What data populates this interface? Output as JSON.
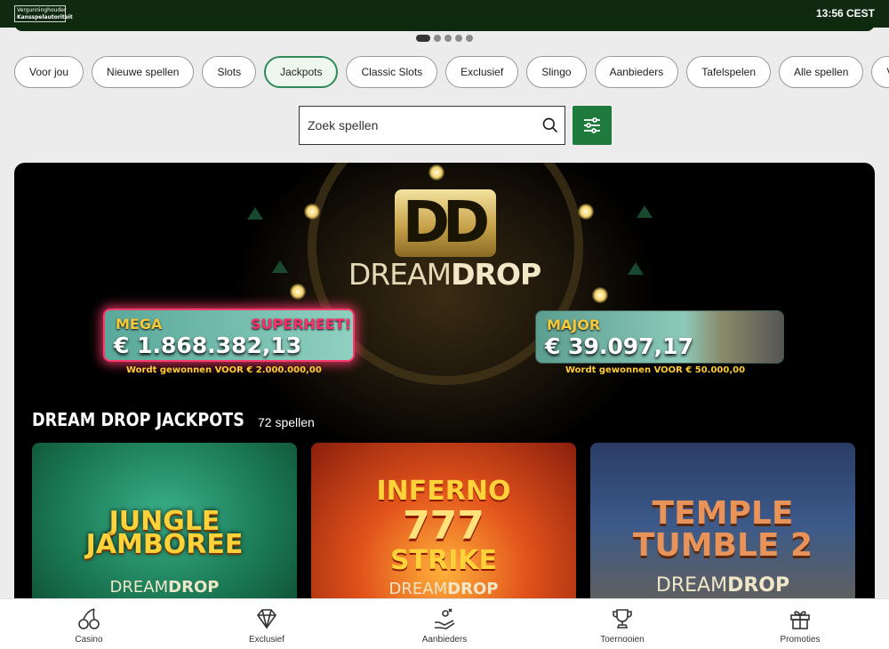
{
  "header": {
    "license_line1": "Vergunninghouder",
    "license_line2": "Kansspelautoriteit",
    "clock": "13:56 CEST"
  },
  "carousel": {
    "dot_count": 5,
    "active_index": 0
  },
  "filters": {
    "chips": [
      {
        "label": "Voor jou"
      },
      {
        "label": "Nieuwe spellen"
      },
      {
        "label": "Slots"
      },
      {
        "label": "Jackpots",
        "active": true
      },
      {
        "label": "Classic Slots"
      },
      {
        "label": "Exclusief"
      },
      {
        "label": "Slingo"
      },
      {
        "label": "Aanbieders"
      },
      {
        "label": "Tafelspelen"
      },
      {
        "label": "Alle spellen"
      },
      {
        "label": "V"
      }
    ]
  },
  "search": {
    "placeholder": "Zoek spellen",
    "icon": "search-icon",
    "filter_icon": "sliders-icon"
  },
  "banner": {
    "logo_letters": "DD",
    "brand_light": "DREAM",
    "brand_bold": "DROP",
    "jackpots": [
      {
        "label": "MEGA",
        "status": "SUPERHEET!",
        "amount": "€ 1.868.382,13",
        "note": "Wordt gewonnen VOOR € 2.000.000,00"
      },
      {
        "label": "MAJOR",
        "amount": "€ 39.097,17",
        "note": "Wordt gewonnen VOOR € 50.000,00"
      }
    ],
    "section_title": "DREAM DROP JACKPOTS",
    "section_count": "72 spellen",
    "games": [
      {
        "title_line1": "JUNGLE",
        "title_line2": "JAMBOREE",
        "sub_light": "DREAM",
        "sub_bold": "DROP"
      },
      {
        "title_line1": "INFERNO",
        "title_line2": "777",
        "title_line3": "STRIKE",
        "sub_light": "DREAM",
        "sub_bold": "DROP"
      },
      {
        "title_line1": "TEMPLE",
        "title_line2": "TUMBLE 2",
        "sub_light": "DREAM",
        "sub_bold": "DROP"
      }
    ]
  },
  "colors": {
    "accent": "#1f7a3d",
    "topbar": "#0f2a10",
    "jackpot_gold": "#f6c83b",
    "hot_pink": "#ff2d6a"
  },
  "bottom_nav": [
    {
      "label": "Casino",
      "icon": "cherries-icon"
    },
    {
      "label": "Exclusief",
      "icon": "diamond-icon"
    },
    {
      "label": "Aanbieders",
      "icon": "hand-icon"
    },
    {
      "label": "Toernooien",
      "icon": "trophy-icon"
    },
    {
      "label": "Promoties",
      "icon": "gift-icon"
    }
  ]
}
